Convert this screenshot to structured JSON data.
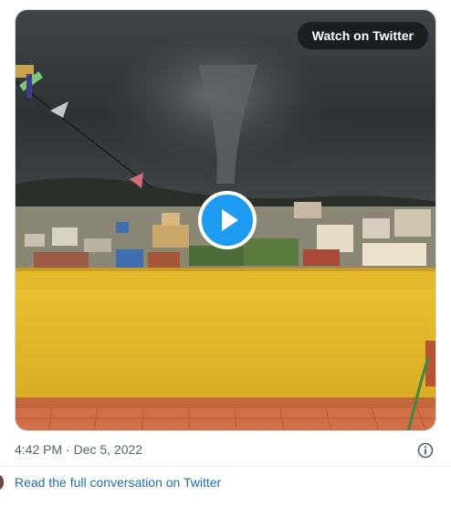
{
  "embed": {
    "watch_label": "Watch on Twitter",
    "timestamp": "4:42 PM · Dec 5, 2022",
    "read_more_label": "Read the full conversation on Twitter"
  },
  "icons": {
    "play": "play-icon",
    "info": "info-icon"
  },
  "colors": {
    "accent": "#1d9bf0",
    "link": "#1d6fb8",
    "muted_text": "#536471"
  }
}
